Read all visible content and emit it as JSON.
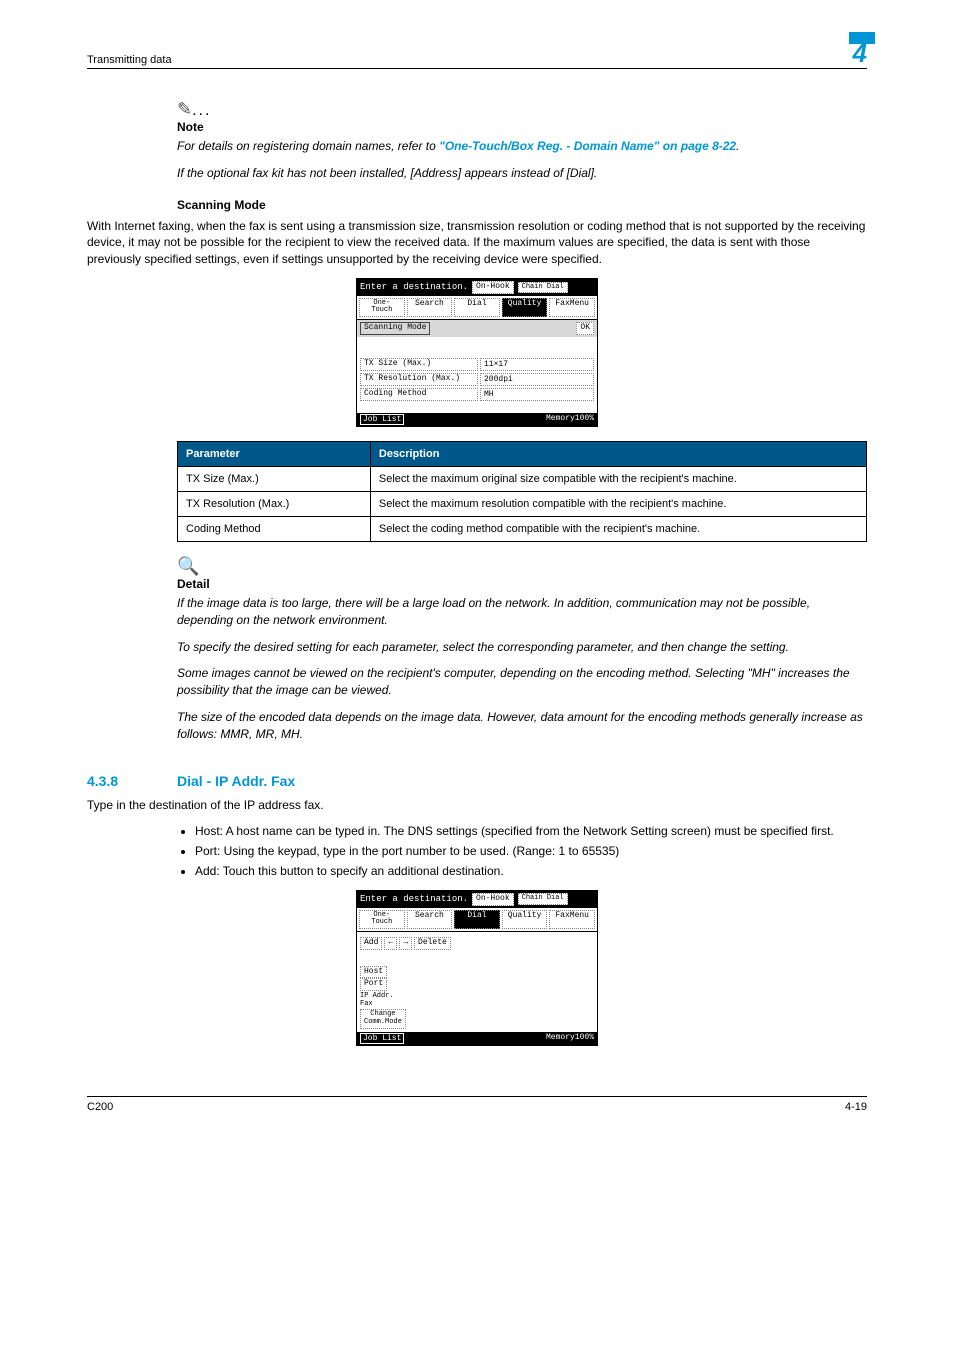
{
  "header": {
    "left": "Transmitting data",
    "right": "4"
  },
  "note": {
    "label": "Note",
    "p1a": "For details on registering domain names, refer to ",
    "p1link": "\"One-Touch/Box Reg. - Domain Name\" on page 8-22",
    "p1b": ".",
    "p2": "If the optional fax kit has not been installed, [Address] appears instead of [Dial]."
  },
  "scanning": {
    "title": "Scanning Mode",
    "para": "With Internet faxing, when the fax is sent using a transmission size, transmission resolution or coding method that is not supported by the receiving device, it may not be possible for the recipient to view the received data. If the maximum values are specified, the data is sent with those previously specified settings, even if settings unsupported by the receiving device were specified."
  },
  "scr_common": {
    "enter_dest": "Enter a destination.",
    "onhook": "On-Hook",
    "chain": "Chain Dial",
    "tabs": {
      "onetouch": "One-\nTouch",
      "search": "Search",
      "dial": "Dial",
      "quality": "Quality",
      "faxmenu": "FaxMenu"
    },
    "joblist": "Job List",
    "memory": "Memory100%"
  },
  "scr1": {
    "mode_label": "Scanning Mode",
    "ok": "OK",
    "rows": [
      {
        "label": "TX Size (Max.)",
        "value": "11×17"
      },
      {
        "label": "TX Resolution (Max.)",
        "value": "200dpi"
      },
      {
        "label": "Coding Method",
        "value": "MH"
      }
    ]
  },
  "table": {
    "h1": "Parameter",
    "h2": "Description",
    "rows": [
      {
        "p": "TX Size (Max.)",
        "d": "Select the maximum original size compatible with the recipient's machine."
      },
      {
        "p": "TX Resolution (Max.)",
        "d": "Select the maximum resolution compatible with the recipient's machine."
      },
      {
        "p": "Coding Method",
        "d": "Select the coding method compatible with the recipient's machine."
      }
    ]
  },
  "detail": {
    "label": "Detail",
    "p1": "If the image data is too large, there will be a large load on the network. In addition, communication may not be possible, depending on the network environment.",
    "p2": "To specify the desired setting for each parameter, select the corresponding parameter, and then change the setting.",
    "p3": "Some images cannot be viewed on the recipient's computer, depending on the encoding method. Selecting \"MH\" increases the possibility that the image can be viewed.",
    "p4": "The size of the encoded data depends on the image data. However, data amount for the encoding methods generally increase as follows: MMR, MR, MH."
  },
  "sec438": {
    "num": "4.3.8",
    "title": "Dial - IP Addr. Fax",
    "intro": "Type in the destination of the IP address fax.",
    "bullets": [
      "Host: A host name can be typed in. The DNS settings (specified from the Network Setting screen) must be specified first.",
      "Port: Using the keypad, type in the port number to be used. (Range: 1 to 65535)",
      "Add: Touch this button to specify an additional destination."
    ]
  },
  "scr2": {
    "toolbar": {
      "add": "Add",
      "left": "←",
      "right": "→",
      "delete": "Delete"
    },
    "items": {
      "host": "Host",
      "port": "Port",
      "ipaddr": "IP Addr.\nFax",
      "change": "Change\nComm.Mode"
    }
  },
  "footer": {
    "left": "C200",
    "right": "4-19"
  }
}
